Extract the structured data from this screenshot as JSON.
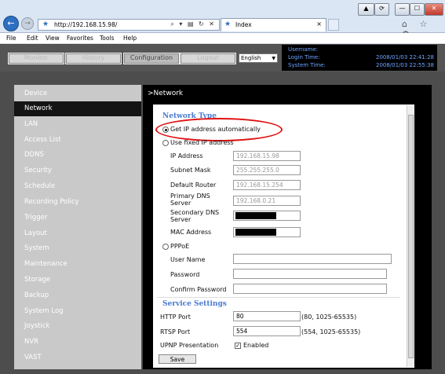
{
  "browser": {
    "address": "http://192.168.15.98/",
    "address_controls": "⌕ ▾ ▤ ↻ ✕",
    "tab_title": "Index",
    "tab_close": "×",
    "window_buttons": [
      "▲",
      "⟳",
      "—",
      "☐",
      "✕"
    ],
    "tool_icons": "⌂ ☆ ⚙",
    "menu": [
      "File",
      "Edit",
      "View",
      "Favorites",
      "Tools",
      "Help"
    ]
  },
  "header": {
    "buttons": [
      "Monitor",
      "History",
      "Configuration",
      "Logout"
    ],
    "active_button": "Configuration",
    "language": "English",
    "username_label": "Username:",
    "login_time_label": "Login Time:",
    "login_time": "2008/01/03 22:41:28",
    "system_time_label": "System Time:",
    "system_time": "2008/01/03 22:55:38"
  },
  "sidebar": {
    "items": [
      "Device",
      "Network",
      "LAN",
      "Access List",
      "DDNS",
      "Security",
      "Schedule",
      "Recording Policy",
      "Trigger",
      "Layout",
      "System",
      "Maintenance",
      "Storage",
      "Backup",
      "System Log",
      "Joystick",
      "NVR",
      "VAST"
    ],
    "active": "Network"
  },
  "page": {
    "title": ">Network"
  },
  "network": {
    "section_title": "Network Type",
    "option_auto": "Get IP address automatically",
    "option_fixed": "Use fixed IP address",
    "fields": [
      {
        "label": "IP Address",
        "value": "192.168.15.98"
      },
      {
        "label": "Subnet Mask",
        "value": "255.255.255.0"
      },
      {
        "label": "Default Router",
        "value": "192.168.15.254"
      },
      {
        "label": "Primary DNS Server",
        "value": "192.168.0.21"
      },
      {
        "label": "Secondary DNS Server",
        "value": ""
      },
      {
        "label": "MAC Address",
        "value": ""
      }
    ],
    "option_pppoe": "PPPoE",
    "pppoe_fields": [
      "User Name",
      "Password",
      "Confirm Password"
    ]
  },
  "service": {
    "section_title": "Service Settings",
    "http_label": "HTTP Port",
    "http_value": "80",
    "http_hint": "(80, 1025-65535)",
    "rtsp_label": "RTSP Port",
    "rtsp_value": "554",
    "rtsp_hint": "(554, 1025-65535)",
    "upnp_label": "UPNP Presentation",
    "upnp_check_label": "Enabled",
    "upnp_checked": true
  },
  "save_label": "Save",
  "colors": {
    "accent": "#4a7ad0",
    "highlight_ring": "#e01010",
    "sidebar_bg": "#c9c9c9",
    "content_bg": "#000000"
  }
}
